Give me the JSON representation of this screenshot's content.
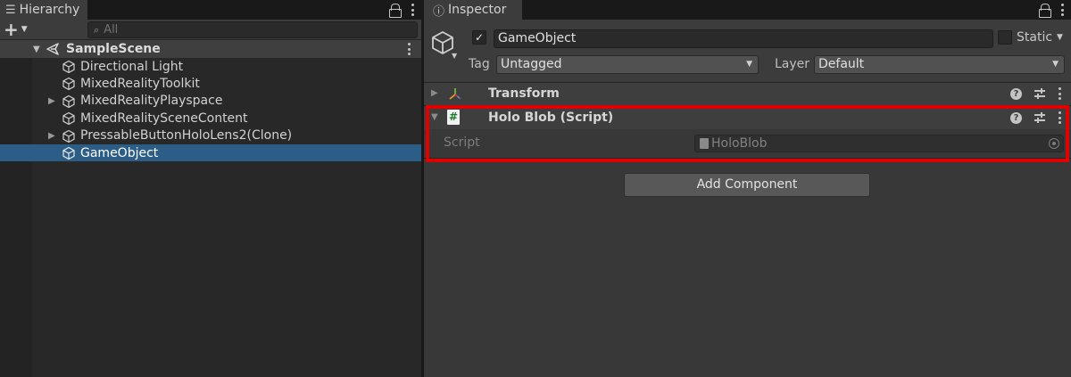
{
  "hierarchy": {
    "tab_label": "Hierarchy",
    "search_placeholder": "All",
    "scene": {
      "name": "SampleScene"
    },
    "items": [
      {
        "label": "Directional Light",
        "expandable": false,
        "selected": false
      },
      {
        "label": "MixedRealityToolkit",
        "expandable": false,
        "selected": false
      },
      {
        "label": "MixedRealityPlayspace",
        "expandable": true,
        "selected": false
      },
      {
        "label": "MixedRealitySceneContent",
        "expandable": false,
        "selected": false
      },
      {
        "label": "PressableButtonHoloLens2(Clone)",
        "expandable": true,
        "selected": false
      },
      {
        "label": "GameObject",
        "expandable": false,
        "selected": true
      }
    ]
  },
  "inspector": {
    "tab_label": "Inspector",
    "object_name": "GameObject",
    "active": true,
    "static_label": "Static",
    "tag_label": "Tag",
    "tag_value": "Untagged",
    "layer_label": "Layer",
    "layer_value": "Default",
    "components": {
      "transform": {
        "title": "Transform"
      },
      "script": {
        "title": "Holo Blob (Script)",
        "field_label": "Script",
        "field_value": "HoloBlob"
      }
    },
    "add_component_label": "Add Component"
  },
  "colors": {
    "selection": "#2c5d87",
    "highlight_border": "#e00000",
    "panel_bg": "#383838",
    "hierarchy_bg": "#282828"
  }
}
